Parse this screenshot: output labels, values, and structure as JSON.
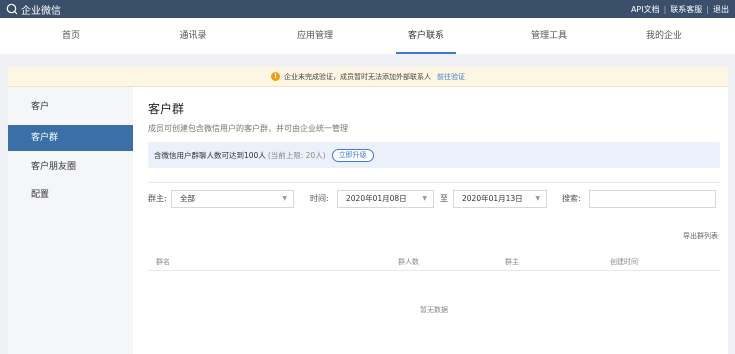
{
  "topbar": {
    "logo_text": "企业微信",
    "links": [
      "API文档",
      "联系客服",
      "退出"
    ]
  },
  "nav": {
    "items": [
      "首页",
      "通讯录",
      "应用管理",
      "客户联系",
      "管理工具",
      "我的企业"
    ],
    "active": "客户联系"
  },
  "alert": {
    "text": "企业未完成验证，成员暂时无法添加外部联系人",
    "link": "前往验证"
  },
  "sidebar": {
    "items": [
      "客户",
      "客户群",
      "客户朋友圈",
      "配置"
    ],
    "active": "客户群"
  },
  "main": {
    "title": "客户群",
    "description": "成员可创建包含微信用户的客户群，并可由企业统一管理",
    "info": {
      "text": "含微信用户群聊人数可达到100人",
      "limit": "(当前上限: 20人)",
      "upgrade_button": "立即升级"
    },
    "filters": {
      "owner_label": "群主:",
      "owner_value": "全部",
      "time_label": "时间:",
      "date_from": "2020年01月08日",
      "to_label": "至",
      "date_to": "2020年01月13日",
      "search_label": "搜索:",
      "search_value": ""
    },
    "export_link": "导出群列表",
    "table": {
      "columns": [
        "群名",
        "群人数",
        "群主",
        "创建时间"
      ]
    },
    "empty_text": "暂无数据"
  },
  "colors": {
    "topbar": "#3a4f6a",
    "accent": "#3a7bd5",
    "sidebar_active": "#3a6fa8",
    "alert_bg": "#fdf6e3",
    "alert_icon": "#f39c12",
    "info_bg": "#eaf1fb"
  }
}
